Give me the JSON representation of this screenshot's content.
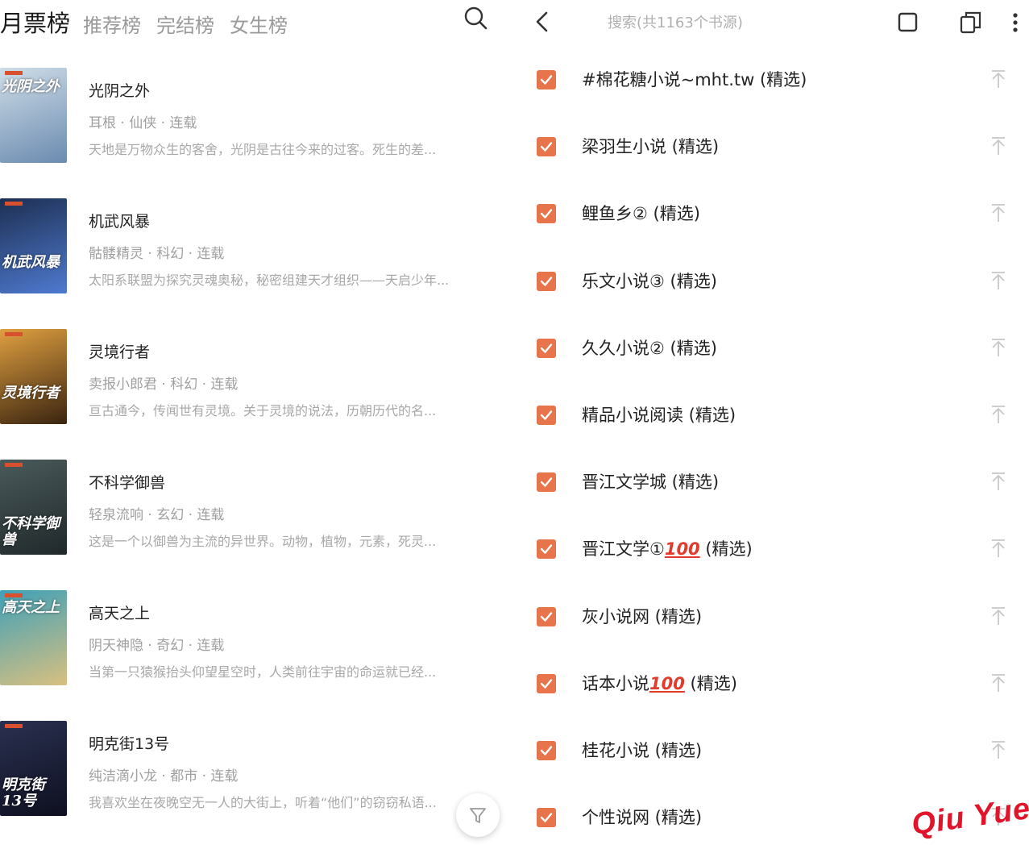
{
  "left_panel": {
    "tabs": [
      {
        "label": "月票榜",
        "active": true
      },
      {
        "label": "推荐榜",
        "active": false
      },
      {
        "label": "完结榜",
        "active": false
      },
      {
        "label": "女生榜",
        "active": false
      }
    ],
    "search_icon": "search-icon",
    "books": [
      {
        "title": "光阴之外",
        "meta": "耳根 · 仙侠 · 连载",
        "desc": "天地是万物众生的客舍，光阴是古往今来的过客。死生的差...",
        "cover_text": "光阴之外",
        "cover_colors": [
          "#cfdde8",
          "#6b8bb0"
        ]
      },
      {
        "title": "机武风暴",
        "meta": "骷髅精灵 · 科幻 · 连载",
        "desc": "太阳系联盟为探究灵魂奥秘，秘密组建天才组织——天启少年...",
        "cover_text": "机武风暴",
        "cover_colors": [
          "#1d2f52",
          "#4f7ad0"
        ]
      },
      {
        "title": "灵境行者",
        "meta": "卖报小郎君 · 科幻 · 连载",
        "desc": "亘古通今，传闻世有灵境。关于灵境的说法，历朝历代的名...",
        "cover_text": "灵境行者",
        "cover_colors": [
          "#e0a040",
          "#3a2410"
        ]
      },
      {
        "title": "不科学御兽",
        "meta": "轻泉流响 · 玄幻 · 连载",
        "desc": "这是一个以御兽为主流的异世界。动物，植物，元素，死灵...",
        "cover_text": "不科学御兽",
        "cover_colors": [
          "#4a5a5a",
          "#20282a"
        ]
      },
      {
        "title": "高天之上",
        "meta": "阴天神隐 · 奇幻 · 连载",
        "desc": "当第一只猿猴抬头仰望星空时，人类前往宇宙的命运就已经...",
        "cover_text": "高天之上",
        "cover_colors": [
          "#3fa0b8",
          "#d8c080"
        ]
      },
      {
        "title": "明克街13号",
        "meta": "纯洁滴小龙 · 都市 · 连载",
        "desc": "我喜欢坐在夜晚空无一人的大街上，听着“他们”的窃窃私语...",
        "cover_text": "明克街13号",
        "cover_colors": [
          "#2a3050",
          "#0e1020"
        ]
      }
    ],
    "filter_icon": "filter-icon"
  },
  "right_panel": {
    "back_icon": "chevron-left-icon",
    "search_title": "搜索(共1163个书源)",
    "toolbar_icons": [
      "select-all-icon",
      "copy-icon",
      "more-vertical-icon"
    ],
    "accent_color": "#e7744a",
    "sources": [
      {
        "name": "#棉花糖小说~mht.tw (精选)",
        "checked": true
      },
      {
        "name": "梁羽生小说 (精选)",
        "checked": true
      },
      {
        "name": "鲤鱼乡② (精选)",
        "checked": true
      },
      {
        "name": "乐文小说③ (精选)",
        "checked": true
      },
      {
        "name": "久久小说② (精选)",
        "checked": true
      },
      {
        "name": "精品小说阅读 (精选)",
        "checked": true
      },
      {
        "name": "晋江文学城 (精选)",
        "checked": true
      },
      {
        "name": "晋江文学①",
        "badge": "100",
        "suffix": " (精选)",
        "checked": true
      },
      {
        "name": "灰小说网 (精选)",
        "checked": true
      },
      {
        "name": "话本小说",
        "badge": "100",
        "suffix": " (精选)",
        "checked": true
      },
      {
        "name": "桂花小说 (精选)",
        "checked": true
      },
      {
        "name": "个性说网 (精选)",
        "checked": true
      }
    ]
  },
  "watermark": "Qiu Yue"
}
